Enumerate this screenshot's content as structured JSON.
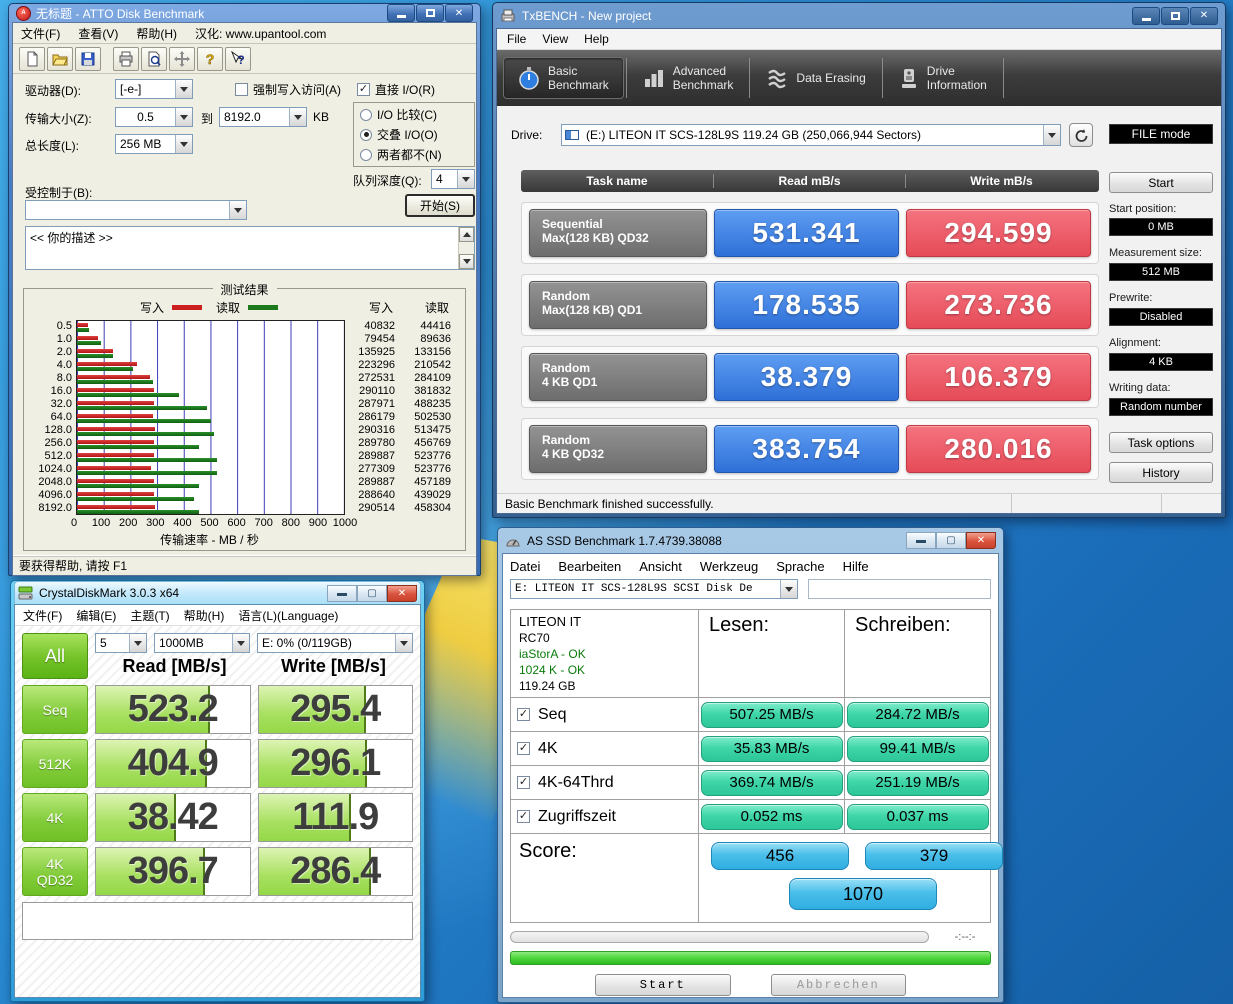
{
  "atto": {
    "title": "无标题 - ATTO Disk Benchmark",
    "menu": [
      "文件(F)",
      "查看(V)",
      "帮助(H)",
      "汉化: www.upantool.com"
    ],
    "fields": {
      "drive_label": "驱动器(D):",
      "drive_value": "[-e-]",
      "force_write_label": "强制写入访问(A)",
      "direct_io_label": "直接 I/O(R)",
      "transfer_label": "传输大小(Z):",
      "transfer_from": "0.5",
      "to_label": "到",
      "transfer_to": "8192.0",
      "kb_label": "KB",
      "io_compare_label": "I/O 比较(C)",
      "overlap_io_label": "交叠 I/O(O)",
      "neither_label": "两者都不(N)",
      "total_length_label": "总长度(L):",
      "total_length_value": "256 MB",
      "queue_depth_label": "队列深度(Q):",
      "queue_depth_value": "4",
      "controlled_by_label": "受控制于(B):",
      "start_button": "开始(S)",
      "description_text": "<<   你的描述   >>"
    },
    "results_title": "测试结果",
    "legend_write": "写入",
    "legend_read": "读取",
    "col_write": "写入",
    "col_read": "读取",
    "chart_data": {
      "type": "bar",
      "orientation": "horizontal",
      "categories": [
        "0.5",
        "1.0",
        "2.0",
        "4.0",
        "8.0",
        "16.0",
        "32.0",
        "64.0",
        "128.0",
        "256.0",
        "512.0",
        "1024.0",
        "2048.0",
        "4096.0",
        "8192.0"
      ],
      "series": [
        {
          "name": "写入",
          "color": "#cc2020",
          "values": [
            40832,
            79454,
            135925,
            223296,
            272531,
            290110,
            287971,
            286179,
            290316,
            289780,
            289887,
            277309,
            289887,
            288640,
            290514
          ]
        },
        {
          "name": "读取",
          "color": "#1c7a1c",
          "values": [
            44416,
            89636,
            133156,
            210542,
            284109,
            381832,
            488235,
            502530,
            513475,
            456769,
            523776,
            523776,
            457189,
            439029,
            458304
          ]
        }
      ],
      "x_ticks": [
        "0",
        "100",
        "200",
        "300",
        "400",
        "500",
        "600",
        "700",
        "800",
        "900",
        "1000"
      ],
      "xlabel": "传输速率 - MB / 秒",
      "xlim": [
        0,
        1000
      ],
      "value_scale_divisor": 1000,
      "grid": "vertical"
    },
    "status": "要获得帮助, 请按 F1"
  },
  "txbench": {
    "title": "TxBENCH - New project",
    "menu": [
      "File",
      "View",
      "Help"
    ],
    "tabs": [
      {
        "line1": "Basic",
        "line2": "Benchmark"
      },
      {
        "line1": "Advanced",
        "line2": "Benchmark"
      },
      {
        "line1": "Data Erasing",
        "line2": ""
      },
      {
        "line1": "Drive",
        "line2": "Information"
      }
    ],
    "drive_label": "Drive:",
    "drive_value": "(E:) LITEON IT SCS-128L9S  119.24 GB (250,066,944 Sectors)",
    "file_mode": "FILE mode",
    "table_headers": [
      "Task name",
      "Read mB/s",
      "Write mB/s"
    ],
    "tasks": [
      {
        "name1": "Sequential",
        "name2": "Max(128 KB) QD32",
        "read": "531.341",
        "write": "294.599"
      },
      {
        "name1": "Random",
        "name2": "Max(128 KB) QD1",
        "read": "178.535",
        "write": "273.736"
      },
      {
        "name1": "Random",
        "name2": "4 KB QD1",
        "read": "38.379",
        "write": "106.379"
      },
      {
        "name1": "Random",
        "name2": "4 KB QD32",
        "read": "383.754",
        "write": "280.016"
      }
    ],
    "sidebar": {
      "start_button": "Start",
      "start_position_label": "Start position:",
      "start_position_value": "0 MB",
      "measurement_label": "Measurement size:",
      "measurement_value": "512 MB",
      "prewrite_label": "Prewrite:",
      "prewrite_value": "Disabled",
      "alignment_label": "Alignment:",
      "alignment_value": "4 KB",
      "writing_label": "Writing data:",
      "writing_value": "Random number",
      "task_options_button": "Task options",
      "history_button": "History"
    },
    "status": "Basic Benchmark finished successfully."
  },
  "cdm": {
    "title": "CrystalDiskMark 3.0.3 x64",
    "menu": [
      "文件(F)",
      "编辑(E)",
      "主题(T)",
      "帮助(H)",
      "语言(L)(Language)"
    ],
    "all_button": "All",
    "selects": [
      "5",
      "1000MB",
      "E: 0% (0/119GB)"
    ],
    "read_header": "Read [MB/s]",
    "write_header": "Write [MB/s]",
    "chart_data": {
      "type": "table",
      "columns": [
        "Test",
        "Read MB/s",
        "Write MB/s"
      ],
      "rows": [
        {
          "label": "Seq",
          "read": "523.2",
          "write": "295.4",
          "read_fill": 74,
          "write_fill": 70
        },
        {
          "label": "512K",
          "read": "404.9",
          "write": "296.1",
          "read_fill": 72,
          "write_fill": 71
        },
        {
          "label": "4K",
          "read": "38.42",
          "write": "111.9",
          "read_fill": 52,
          "write_fill": 60
        },
        {
          "label": "4K\nQD32",
          "read": "396.7",
          "write": "286.4",
          "read_fill": 71,
          "write_fill": 73
        }
      ]
    }
  },
  "asssd": {
    "title": "AS SSD Benchmark 1.7.4739.38088",
    "menu": [
      "Datei",
      "Bearbeiten",
      "Ansicht",
      "Werkzeug",
      "Sprache",
      "Hilfe"
    ],
    "drive_select": "E: LITEON IT SCS-128L9S SCSI Disk De",
    "info": [
      "LITEON IT",
      "RC70",
      "iaStorA - OK",
      "1024 K - OK",
      "119.24 GB"
    ],
    "read_header": "Lesen:",
    "write_header": "Schreiben:",
    "chart_data": {
      "type": "table",
      "columns": [
        "Test",
        "Lesen",
        "Schreiben"
      ],
      "rows": [
        {
          "label": "Seq",
          "read": "507.25 MB/s",
          "write": "284.72 MB/s"
        },
        {
          "label": "4K",
          "read": "35.83 MB/s",
          "write": "99.41 MB/s"
        },
        {
          "label": "4K-64Thrd",
          "read": "369.74 MB/s",
          "write": "251.19 MB/s"
        },
        {
          "label": "Zugriffszeit",
          "read": "0.052 ms",
          "write": "0.037 ms"
        }
      ]
    },
    "score_label": "Score:",
    "scores": {
      "read": "456",
      "write": "379",
      "total": "1070"
    },
    "time_remaining": "-:--:-",
    "start_button": "Start",
    "cancel_button": "Abbrechen"
  }
}
